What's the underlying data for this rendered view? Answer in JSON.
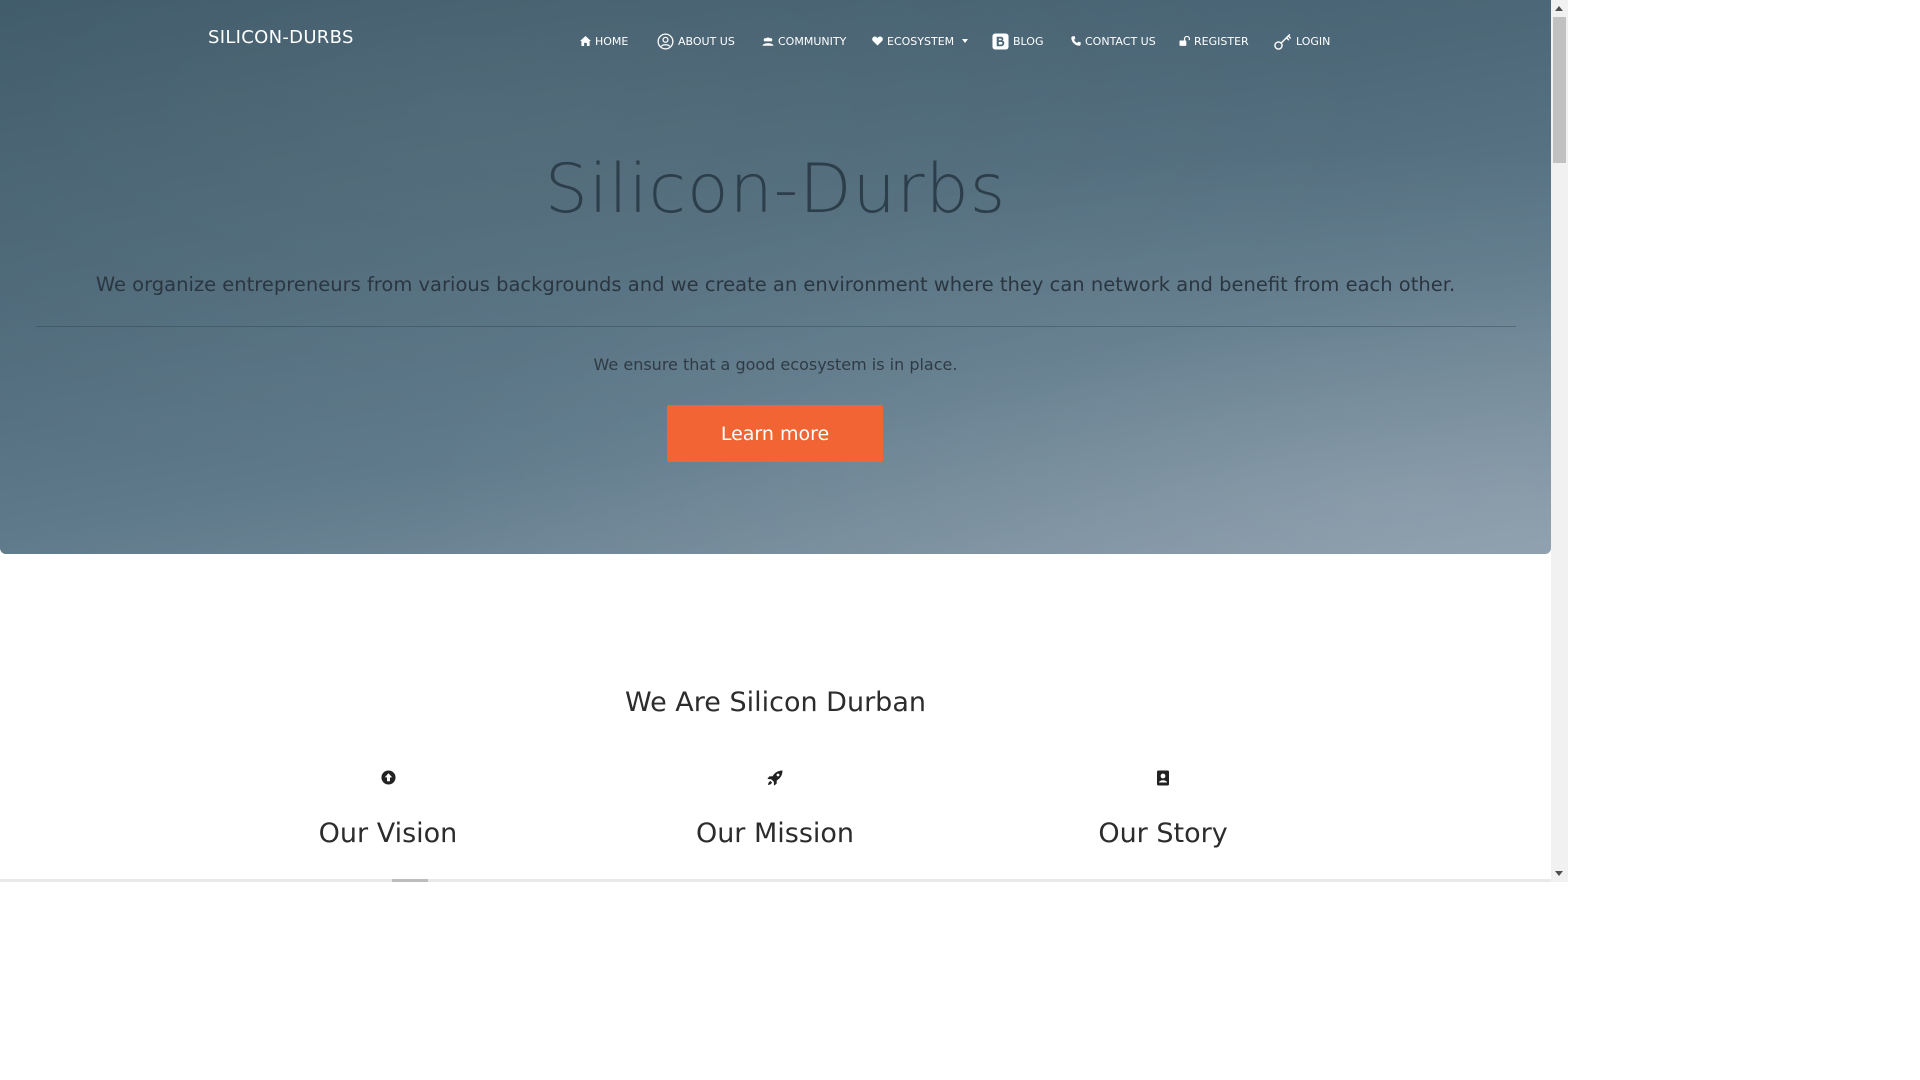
{
  "brand": "SILICON-DURBS",
  "nav": [
    {
      "label": "HOME",
      "icon": "home-icon"
    },
    {
      "label": "ABOUT US",
      "icon": "user-circle-icon"
    },
    {
      "label": "COMMUNITY",
      "icon": "users-icon"
    },
    {
      "label": "ECOSYSTEM",
      "icon": "heart-icon",
      "dropdown": true
    },
    {
      "label": "BLOG",
      "icon": "blogger-icon"
    },
    {
      "label": "CONTACT US",
      "icon": "phone-icon"
    },
    {
      "label": "REGISTER",
      "icon": "unlock-icon"
    },
    {
      "label": "LOGIN",
      "icon": "key-icon"
    }
  ],
  "hero": {
    "title": "Silicon-Durbs",
    "lead": "We organize entrepreneurs from various backgrounds and we create an environment where they can network and benefit from each other.",
    "sub": "We ensure that a good ecosystem is in place.",
    "button": "Learn more"
  },
  "section": {
    "title": "We Are Silicon Durban",
    "features": [
      {
        "title": "Our Vision",
        "icon": "arrow-circle-up-icon"
      },
      {
        "title": "Our Mission",
        "icon": "rocket-icon"
      },
      {
        "title": "Our Story",
        "icon": "address-book-icon"
      }
    ]
  },
  "colors": {
    "accent": "#f26433",
    "hero_bg": "#4d6878",
    "text_dark": "#2c2c2c"
  }
}
